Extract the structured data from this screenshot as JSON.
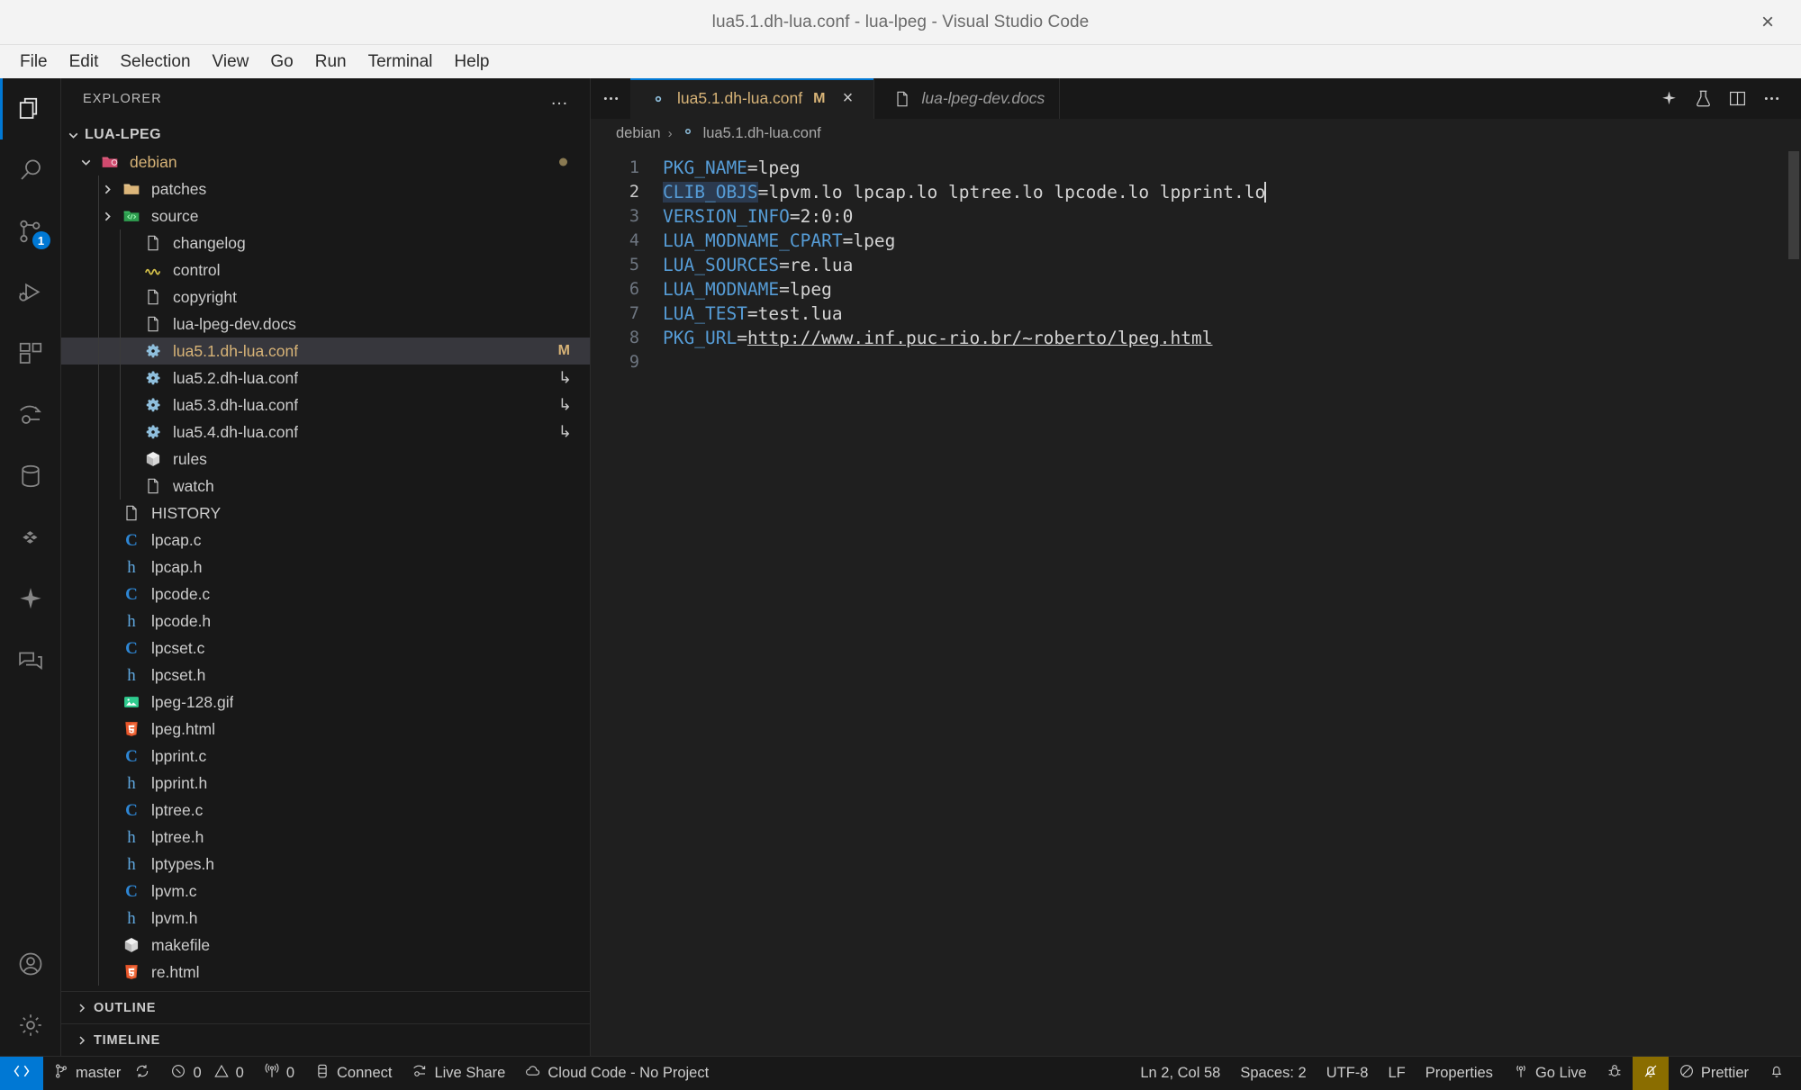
{
  "window": {
    "title": "lua5.1.dh-lua.conf - lua-lpeg - Visual Studio Code",
    "close_label": "×"
  },
  "menubar": {
    "items": [
      {
        "label": "File"
      },
      {
        "label": "Edit"
      },
      {
        "label": "Selection"
      },
      {
        "label": "View"
      },
      {
        "label": "Go"
      },
      {
        "label": "Run"
      },
      {
        "label": "Terminal"
      },
      {
        "label": "Help"
      }
    ]
  },
  "activitybar": {
    "items": [
      {
        "name": "explorer",
        "icon": "files-icon",
        "active": true
      },
      {
        "name": "search",
        "icon": "search-icon",
        "active": false
      },
      {
        "name": "source-control",
        "icon": "source-control-icon",
        "active": false,
        "badge": "1"
      },
      {
        "name": "run-and-debug",
        "icon": "run-debug-icon",
        "active": false
      },
      {
        "name": "extensions",
        "icon": "extensions-icon",
        "active": false
      },
      {
        "name": "live-share",
        "icon": "live-share-icon",
        "active": false
      },
      {
        "name": "database",
        "icon": "database-icon",
        "active": false
      },
      {
        "name": "docker",
        "icon": "docker-icon",
        "active": false
      },
      {
        "name": "copilot",
        "icon": "sparkle-icon",
        "active": false
      },
      {
        "name": "chat",
        "icon": "comment-icon",
        "active": false
      }
    ],
    "bottom": [
      {
        "name": "accounts",
        "icon": "account-icon"
      },
      {
        "name": "manage",
        "icon": "gear-icon"
      }
    ]
  },
  "sidebar": {
    "header_title": "EXPLORER",
    "more_actions": "…",
    "root": {
      "label": "LUA-LPEG",
      "expanded": true
    },
    "tree": [
      {
        "label": "debian",
        "type": "folder",
        "icon": "folder-debian-icon",
        "depth": 1,
        "expanded": true,
        "modified_dot": true,
        "color": "debian"
      },
      {
        "label": "patches",
        "type": "folder",
        "icon": "folder-yellow-icon",
        "depth": 2,
        "expanded": false
      },
      {
        "label": "source",
        "type": "folder",
        "icon": "folder-source-icon",
        "depth": 2,
        "expanded": false
      },
      {
        "label": "changelog",
        "type": "file",
        "icon": "file-blank-icon",
        "depth": 3
      },
      {
        "label": "control",
        "type": "file",
        "icon": "file-control-icon",
        "depth": 3
      },
      {
        "label": "copyright",
        "type": "file",
        "icon": "file-blank-icon",
        "depth": 3
      },
      {
        "label": "lua-lpeg-dev.docs",
        "type": "file",
        "icon": "file-blank-icon",
        "depth": 3
      },
      {
        "label": "lua5.1.dh-lua.conf",
        "type": "file",
        "icon": "file-gear-icon",
        "depth": 3,
        "selected": true,
        "badge": "M"
      },
      {
        "label": "lua5.2.dh-lua.conf",
        "type": "file",
        "icon": "file-gear-icon",
        "depth": 3,
        "symlink": "↳"
      },
      {
        "label": "lua5.3.dh-lua.conf",
        "type": "file",
        "icon": "file-gear-icon",
        "depth": 3,
        "symlink": "↳"
      },
      {
        "label": "lua5.4.dh-lua.conf",
        "type": "file",
        "icon": "file-gear-icon",
        "depth": 3,
        "symlink": "↳"
      },
      {
        "label": "rules",
        "type": "file",
        "icon": "file-makefile-icon",
        "depth": 3
      },
      {
        "label": "watch",
        "type": "file",
        "icon": "file-blank-icon",
        "depth": 3
      },
      {
        "label": "HISTORY",
        "type": "file",
        "icon": "file-blank-icon",
        "depth": 2
      },
      {
        "label": "lpcap.c",
        "type": "file",
        "icon": "file-c-icon",
        "depth": 2
      },
      {
        "label": "lpcap.h",
        "type": "file",
        "icon": "file-h-icon",
        "depth": 2
      },
      {
        "label": "lpcode.c",
        "type": "file",
        "icon": "file-c-icon",
        "depth": 2
      },
      {
        "label": "lpcode.h",
        "type": "file",
        "icon": "file-h-icon",
        "depth": 2
      },
      {
        "label": "lpcset.c",
        "type": "file",
        "icon": "file-c-icon",
        "depth": 2
      },
      {
        "label": "lpcset.h",
        "type": "file",
        "icon": "file-h-icon",
        "depth": 2
      },
      {
        "label": "lpeg-128.gif",
        "type": "file",
        "icon": "file-image-icon",
        "depth": 2
      },
      {
        "label": "lpeg.html",
        "type": "file",
        "icon": "file-html-icon",
        "depth": 2
      },
      {
        "label": "lpprint.c",
        "type": "file",
        "icon": "file-c-icon",
        "depth": 2
      },
      {
        "label": "lpprint.h",
        "type": "file",
        "icon": "file-h-icon",
        "depth": 2
      },
      {
        "label": "lptree.c",
        "type": "file",
        "icon": "file-c-icon",
        "depth": 2
      },
      {
        "label": "lptree.h",
        "type": "file",
        "icon": "file-h-icon",
        "depth": 2
      },
      {
        "label": "lptypes.h",
        "type": "file",
        "icon": "file-h-icon",
        "depth": 2
      },
      {
        "label": "lpvm.c",
        "type": "file",
        "icon": "file-c-icon",
        "depth": 2
      },
      {
        "label": "lpvm.h",
        "type": "file",
        "icon": "file-h-icon",
        "depth": 2
      },
      {
        "label": "makefile",
        "type": "file",
        "icon": "file-makefile-icon",
        "depth": 2
      },
      {
        "label": "re.html",
        "type": "file",
        "icon": "file-html-icon",
        "depth": 2
      }
    ],
    "sections": [
      {
        "label": "OUTLINE",
        "expanded": false
      },
      {
        "label": "TIMELINE",
        "expanded": false
      }
    ]
  },
  "editor": {
    "tabs": [
      {
        "label": "lua5.1.dh-lua.conf",
        "icon": "file-gear-icon",
        "dirty_badge": "M",
        "close": "×",
        "active": true,
        "preview": false
      },
      {
        "label": "lua-lpeg-dev.docs",
        "icon": "file-blank-icon",
        "active": false,
        "preview": true
      }
    ],
    "actions": [
      {
        "name": "copilot-chat-action",
        "icon": "sparkle-icon"
      },
      {
        "name": "run-action",
        "icon": "beaker-icon"
      },
      {
        "name": "split-editor-action",
        "icon": "split-icon"
      },
      {
        "name": "more-actions",
        "icon": "ellipsis-icon"
      }
    ],
    "breadcrumbs": [
      {
        "label": "debian",
        "icon": null
      },
      {
        "label": "lua5.1.dh-lua.conf",
        "icon": "file-gear-icon"
      }
    ],
    "lines": [
      {
        "no": "1",
        "key": "PKG_NAME",
        "value": "lpeg",
        "current": false
      },
      {
        "no": "2",
        "key": "CLIB_OBJS",
        "value": "lpvm.lo lpcap.lo lptree.lo lpcode.lo lpprint.lo",
        "current": true,
        "caret": true,
        "highlight_key": true
      },
      {
        "no": "3",
        "key": "VERSION_INFO",
        "value": "2:0:0",
        "current": false
      },
      {
        "no": "4",
        "key": "LUA_MODNAME_CPART",
        "value": "lpeg",
        "current": false
      },
      {
        "no": "5",
        "key": "LUA_SOURCES",
        "value": "re.lua",
        "current": false
      },
      {
        "no": "6",
        "key": "LUA_MODNAME",
        "value": "lpeg",
        "current": false
      },
      {
        "no": "7",
        "key": "LUA_TEST",
        "value": "test.lua",
        "current": false
      },
      {
        "no": "8",
        "key": "PKG_URL",
        "value": "http://www.inf.puc-rio.br/~roberto/lpeg.html",
        "current": false,
        "is_link": true
      },
      {
        "no": "9",
        "key": "",
        "value": "",
        "current": false
      }
    ]
  },
  "statusbar": {
    "left": [
      {
        "name": "remote-indicator",
        "label": "",
        "icon": "remote-icon",
        "style": "remote"
      },
      {
        "name": "git-branch",
        "label": "master",
        "icon": "branch-icon"
      },
      {
        "name": "git-sync",
        "label": "",
        "icon": "sync-icon"
      },
      {
        "name": "problems",
        "label": "0",
        "icon": "error-icon",
        "label2": "0",
        "icon2": "warning-icon"
      },
      {
        "name": "ports",
        "label": "0",
        "icon": "radio-tower-icon"
      },
      {
        "name": "connect",
        "label": "Connect",
        "icon": "database-plug-icon"
      },
      {
        "name": "live-share",
        "label": "Live Share",
        "icon": "live-share-icon"
      },
      {
        "name": "cloud-code",
        "label": "Cloud Code - No Project",
        "icon": "cloud-icon"
      }
    ],
    "right": [
      {
        "name": "editor-position",
        "label": "Ln 2, Col 58"
      },
      {
        "name": "editor-indentation",
        "label": "Spaces: 2"
      },
      {
        "name": "editor-encoding",
        "label": "UTF-8"
      },
      {
        "name": "editor-eol",
        "label": "LF"
      },
      {
        "name": "editor-language",
        "label": "Properties"
      },
      {
        "name": "go-live",
        "label": "Go Live",
        "icon": "broadcast-icon"
      },
      {
        "name": "debug-extension",
        "label": "",
        "icon": "bug-icon"
      },
      {
        "name": "notifications-do-not-disturb",
        "label": "",
        "icon": "bell-slash-icon",
        "style": "warn"
      },
      {
        "name": "prettier",
        "label": "Prettier",
        "icon": "prohibited-icon"
      },
      {
        "name": "notifications",
        "label": "",
        "icon": "bell-icon"
      }
    ]
  },
  "colors": {
    "accent": "#0078d4",
    "modified": "#d7b377",
    "title_bg": "#f3f3f3",
    "editor_bg": "#1f1f1f",
    "sidebar_bg": "#181818",
    "keyword": "#569cd6",
    "warn_bg": "#8a6d00"
  }
}
